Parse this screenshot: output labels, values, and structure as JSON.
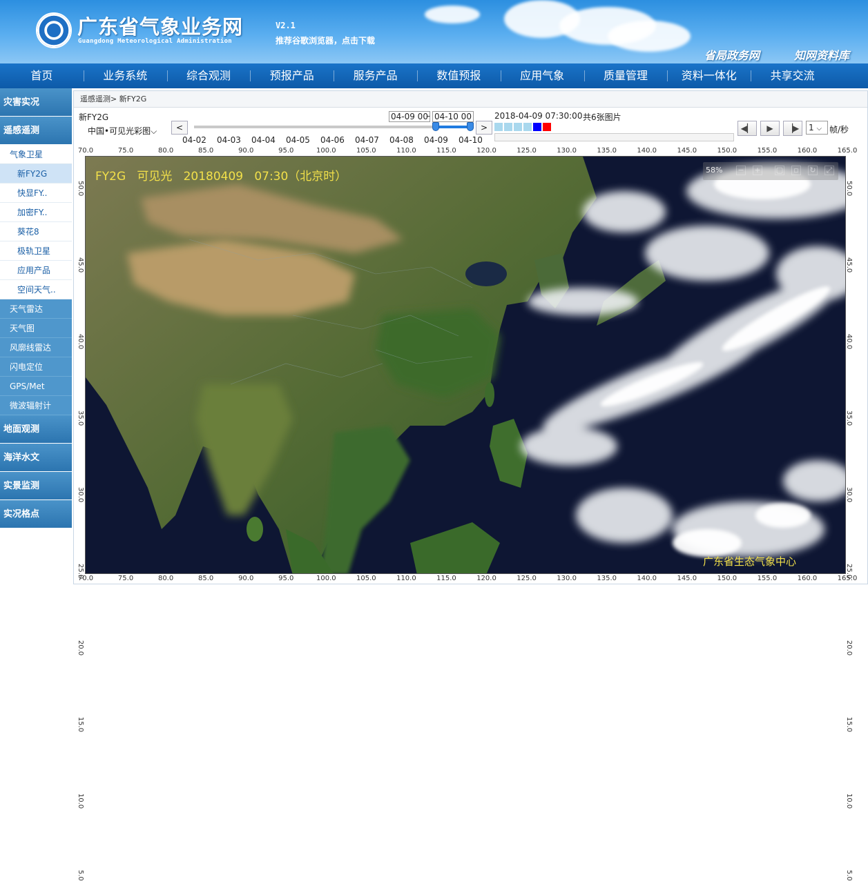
{
  "header": {
    "title": "广东省气象业务网",
    "subtitle": "Guangdong Meteorological Administration",
    "version": "V2.1",
    "browser_tip": "推荐谷歌浏览器，点击下载",
    "links": [
      "省局政务网",
      "知网资料库"
    ]
  },
  "nav": [
    "首页",
    "业务系统",
    "综合观测",
    "预报产品",
    "服务产品",
    "数值预报",
    "应用气象",
    "质量管理",
    "资料一体化",
    "共享交流"
  ],
  "sidebar": {
    "disaster": "灾害实况",
    "remote": "遥感遥测",
    "satellite": "气象卫星",
    "satellite_items": [
      "新FY2G",
      "快显FY..",
      "加密FY..",
      "葵花8",
      "极轨卫星",
      "应用产品",
      "空间天气.."
    ],
    "remote_items": [
      "天气雷达",
      "天气图",
      "风廓线雷达",
      "闪电定位",
      "GPS/Met",
      "微波辐射计"
    ],
    "bottom": [
      "地面观测",
      "海洋水文",
      "实景监测",
      "实况格点"
    ]
  },
  "breadcrumb": "遥感遥测> 新FY2G",
  "controls": {
    "product": "新FY2G",
    "region": "中国•可见光彩图",
    "prev": "<",
    "next": ">",
    "date_from": "04-09 00",
    "date_sep": "–",
    "date_to": "04-10 00",
    "days": [
      "04-02",
      "04-03",
      "04-04",
      "04-05",
      "04-06",
      "04-07",
      "04-08",
      "04-09",
      "04-10"
    ],
    "slider_range": [
      0.875,
      1.0
    ],
    "timestamp": "2018-04-09 07:30:00",
    "frame_count": "共6张图片",
    "frame_colors": [
      "#a9d8ee",
      "#a9d8ee",
      "#a9d8ee",
      "#a9d8ee",
      "#0000ff",
      "#ff0000"
    ],
    "speed": "1",
    "speed_unit": "帧/秒"
  },
  "map": {
    "title": "FY2G   可见光   20180409   07:30（北京时）",
    "zoom": "58%",
    "zoom_buttons": [
      "−",
      "+"
    ],
    "credit": "广东省生态气象中心",
    "lon_ticks": [
      "70.0",
      "75.0",
      "80.0",
      "85.0",
      "90.0",
      "95.0",
      "100.0",
      "105.0",
      "110.0",
      "115.0",
      "120.0",
      "125.0",
      "130.0",
      "135.0",
      "140.0",
      "145.0",
      "150.0",
      "155.0",
      "160.0",
      "165.0"
    ],
    "lat_ticks": [
      "50.0",
      "45.0",
      "40.0",
      "35.0",
      "30.0",
      "25.0",
      "20.0",
      "15.0",
      "10.0",
      "5.0"
    ]
  },
  "icons": {
    "logo": "cma-logo-icon",
    "play_prev": "step-back-icon",
    "play": "play-icon",
    "play_next": "step-forward-icon",
    "dropdown": "chevron-down-icon"
  }
}
